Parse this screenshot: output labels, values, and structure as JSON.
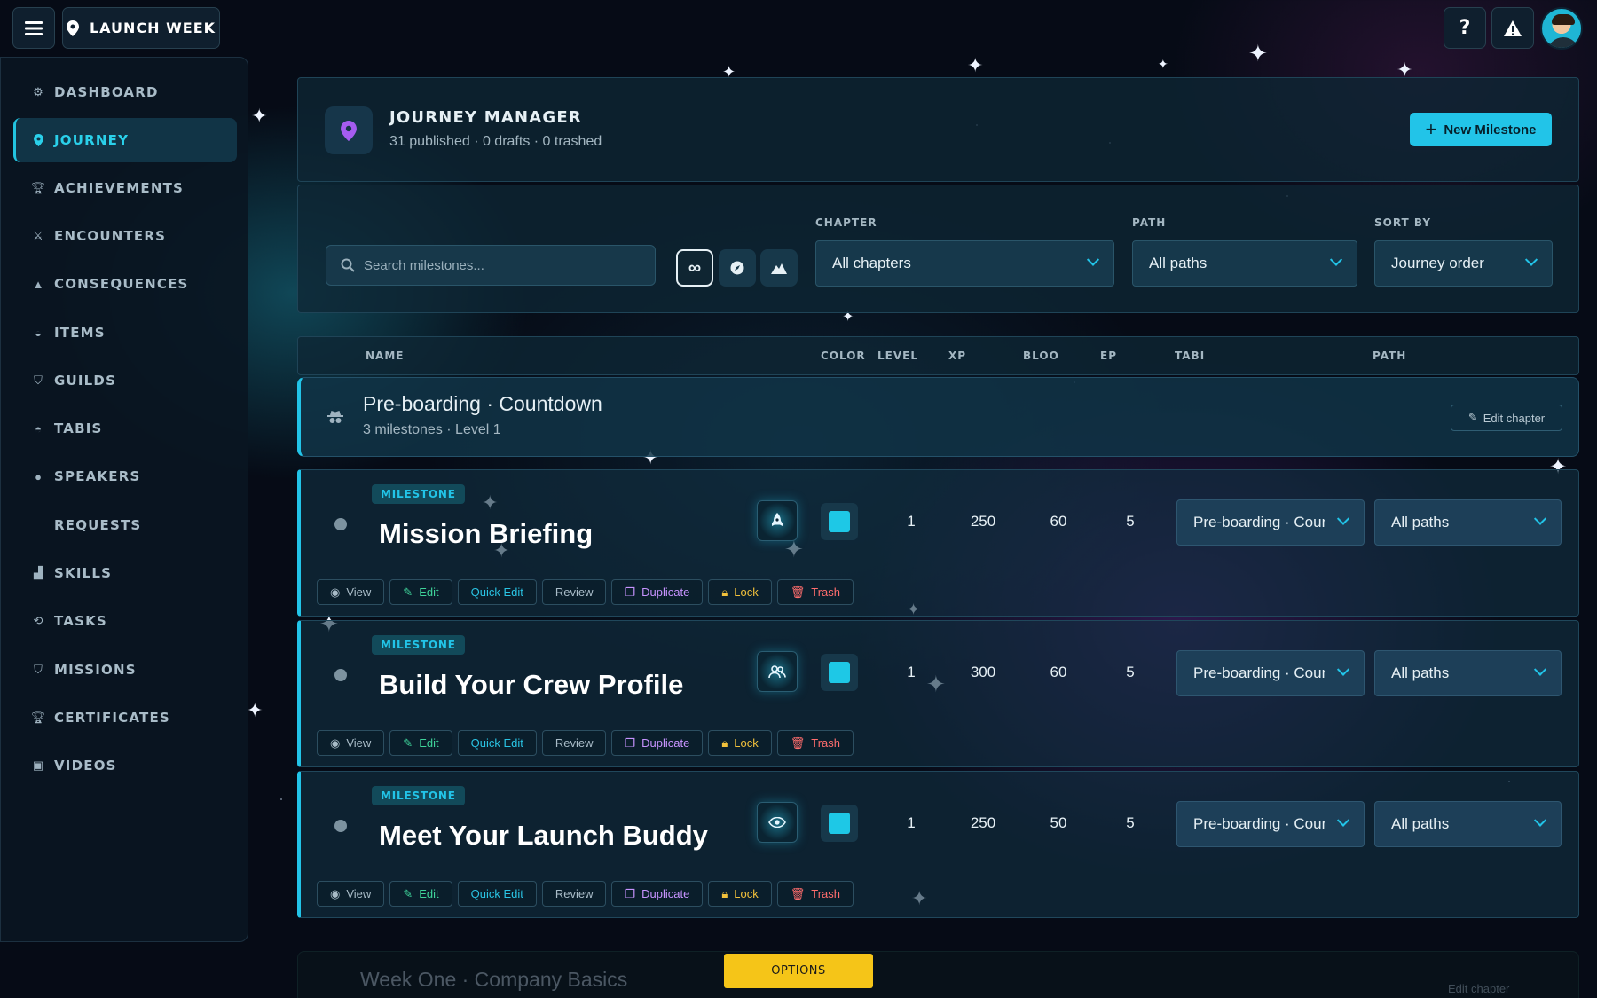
{
  "topbar": {
    "brand_label": "LAUNCH WEEK"
  },
  "sidebar": {
    "items": [
      {
        "label": "DASHBOARD",
        "icon": "gear-icon"
      },
      {
        "label": "JOURNEY",
        "icon": "map-pin-icon",
        "active": true
      },
      {
        "label": "ACHIEVEMENTS",
        "icon": "trophy-icon"
      },
      {
        "label": "ENCOUNTERS",
        "icon": "crossed-swords-icon"
      },
      {
        "label": "CONSEQUENCES",
        "icon": "warning-icon"
      },
      {
        "label": "ITEMS",
        "icon": "basket-icon"
      },
      {
        "label": "GUILDS",
        "icon": "shield-icon"
      },
      {
        "label": "TABIS",
        "icon": "spy-icon"
      },
      {
        "label": "SPEAKERS",
        "icon": "person-icon"
      },
      {
        "label": "REQUESTS",
        "icon": ""
      },
      {
        "label": "SKILLS",
        "icon": "bar-chart-icon"
      },
      {
        "label": "TASKS",
        "icon": "loop-icon"
      },
      {
        "label": "MISSIONS",
        "icon": "shield-icon"
      },
      {
        "label": "CERTIFICATES",
        "icon": "trophy-icon"
      },
      {
        "label": "VIDEOS",
        "icon": "image-icon"
      }
    ]
  },
  "header": {
    "title": "JOURNEY MANAGER",
    "subtitle": "31 published · 0 drafts · 0 trashed",
    "new_button": "New Milestone"
  },
  "filters": {
    "search_placeholder": "Search milestones...",
    "chapter_label": "CHAPTER",
    "chapter_value": "All chapters",
    "path_label": "PATH",
    "path_value": "All paths",
    "sort_label": "SORT BY",
    "sort_value": "Journey order"
  },
  "columns": {
    "name": "NAME",
    "color": "COLOR",
    "level": "LEVEL",
    "xp": "XP",
    "bloo": "BLOO",
    "ep": "EP",
    "tabi": "TABI",
    "path": "PATH"
  },
  "chapter": {
    "title": "Pre-boarding · Countdown",
    "meta": "3 milestones · Level 1",
    "edit_label": "Edit chapter"
  },
  "milestones": [
    {
      "badge": "MILESTONE",
      "name": "Mission Briefing",
      "icon": "rocket-icon",
      "color": "#1ec8e6",
      "level": "1",
      "xp": "250",
      "bloo": "60",
      "ep": "5",
      "tabi": "Pre-boarding · Countdown",
      "path": "All paths"
    },
    {
      "badge": "MILESTONE",
      "name": "Build Your Crew Profile",
      "icon": "people-icon",
      "color": "#1ec8e6",
      "level": "1",
      "xp": "300",
      "bloo": "60",
      "ep": "5",
      "tabi": "Pre-boarding · Countdown",
      "path": "All paths"
    },
    {
      "badge": "MILESTONE",
      "name": "Meet Your Launch Buddy",
      "icon": "eye-icon",
      "color": "#1ec8e6",
      "level": "1",
      "xp": "250",
      "bloo": "50",
      "ep": "5",
      "tabi": "Pre-boarding · Countdown",
      "path": "All paths"
    }
  ],
  "actions": {
    "view": "View",
    "edit": "Edit",
    "quick_edit": "Quick Edit",
    "review": "Review",
    "duplicate": "Duplicate",
    "lock": "Lock",
    "trash": "Trash"
  },
  "next_chapter": {
    "title": "Week One · Company Basics",
    "edit_label": "Edit chapter"
  },
  "options_label": "OPTIONS"
}
